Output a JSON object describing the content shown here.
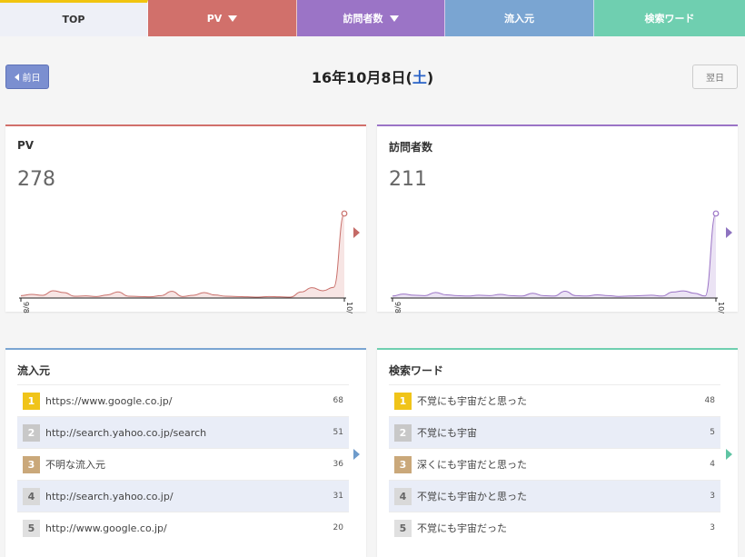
{
  "tabs": [
    {
      "label": "TOP"
    },
    {
      "label": "PV"
    },
    {
      "label": "訪問者数"
    },
    {
      "label": "流入元"
    },
    {
      "label": "検索ワード"
    }
  ],
  "date_nav": {
    "prev_label": "前日",
    "date_text": "16年10月8日(",
    "weekday": "土",
    "date_close": ")",
    "next_label": "翌日"
  },
  "pv_card": {
    "title": "PV",
    "value": "278",
    "accent": "#d1706b",
    "axis_start": "9/8",
    "axis_end": "10/8"
  },
  "visitors_card": {
    "title": "訪問者数",
    "value": "211",
    "accent": "#9b74c6",
    "axis_start": "9/8",
    "axis_end": "10/8"
  },
  "referrers_card": {
    "title": "流入元",
    "accent": "#7aa5d2",
    "items": [
      {
        "rank": "1",
        "label": "https://www.google.co.jp/",
        "count": "68"
      },
      {
        "rank": "2",
        "label": "http://search.yahoo.co.jp/search",
        "count": "51"
      },
      {
        "rank": "3",
        "label": "不明な流入元",
        "count": "36"
      },
      {
        "rank": "4",
        "label": "http://search.yahoo.co.jp/",
        "count": "31"
      },
      {
        "rank": "5",
        "label": "http://www.google.co.jp/",
        "count": "20"
      }
    ]
  },
  "keywords_card": {
    "title": "検索ワード",
    "accent": "#6fcfb0",
    "items": [
      {
        "rank": "1",
        "label": "不覚にも宇宙だと思った",
        "count": "48"
      },
      {
        "rank": "2",
        "label": "不覚にも宇宙",
        "count": "5"
      },
      {
        "rank": "3",
        "label": "深くにも宇宙だと思った",
        "count": "4"
      },
      {
        "rank": "4",
        "label": "不覚にも宇宙かと思った",
        "count": "3"
      },
      {
        "rank": "5",
        "label": "不覚にも宇宙だった",
        "count": "3"
      }
    ]
  },
  "chart_data": [
    {
      "type": "area",
      "x": [
        "9/8",
        "9/9",
        "9/10",
        "9/11",
        "9/12",
        "9/13",
        "9/14",
        "9/15",
        "9/16",
        "9/17",
        "9/18",
        "9/19",
        "9/20",
        "9/21",
        "9/22",
        "9/23",
        "9/24",
        "9/25",
        "9/26",
        "9/27",
        "9/28",
        "9/29",
        "9/30",
        "10/1",
        "10/2",
        "10/3",
        "10/4",
        "10/5",
        "10/6",
        "10/7",
        "10/8"
      ],
      "series": [
        {
          "values": [
            8,
            12,
            9,
            24,
            18,
            6,
            7,
            5,
            10,
            20,
            6,
            5,
            4,
            8,
            22,
            5,
            9,
            18,
            10,
            6,
            5,
            4,
            3,
            5,
            4,
            3,
            20,
            34,
            24,
            35,
            278
          ]
        }
      ],
      "ylim": [
        0,
        278
      ],
      "xlabel": "",
      "ylabel": ""
    },
    {
      "type": "area",
      "x": [
        "9/8",
        "9/9",
        "9/10",
        "9/11",
        "9/12",
        "9/13",
        "9/14",
        "9/15",
        "9/16",
        "9/17",
        "9/18",
        "9/19",
        "9/20",
        "9/21",
        "9/22",
        "9/23",
        "9/24",
        "9/25",
        "9/26",
        "9/27",
        "9/28",
        "9/29",
        "9/30",
        "10/1",
        "10/2",
        "10/3",
        "10/4",
        "10/5",
        "10/6",
        "10/7",
        "10/8"
      ],
      "series": [
        {
          "values": [
            5,
            10,
            7,
            6,
            14,
            8,
            6,
            5,
            7,
            6,
            9,
            6,
            5,
            12,
            6,
            5,
            17,
            6,
            5,
            8,
            6,
            4,
            5,
            6,
            7,
            5,
            15,
            18,
            12,
            5,
            211
          ]
        }
      ],
      "ylim": [
        0,
        211
      ],
      "xlabel": "",
      "ylabel": ""
    }
  ]
}
